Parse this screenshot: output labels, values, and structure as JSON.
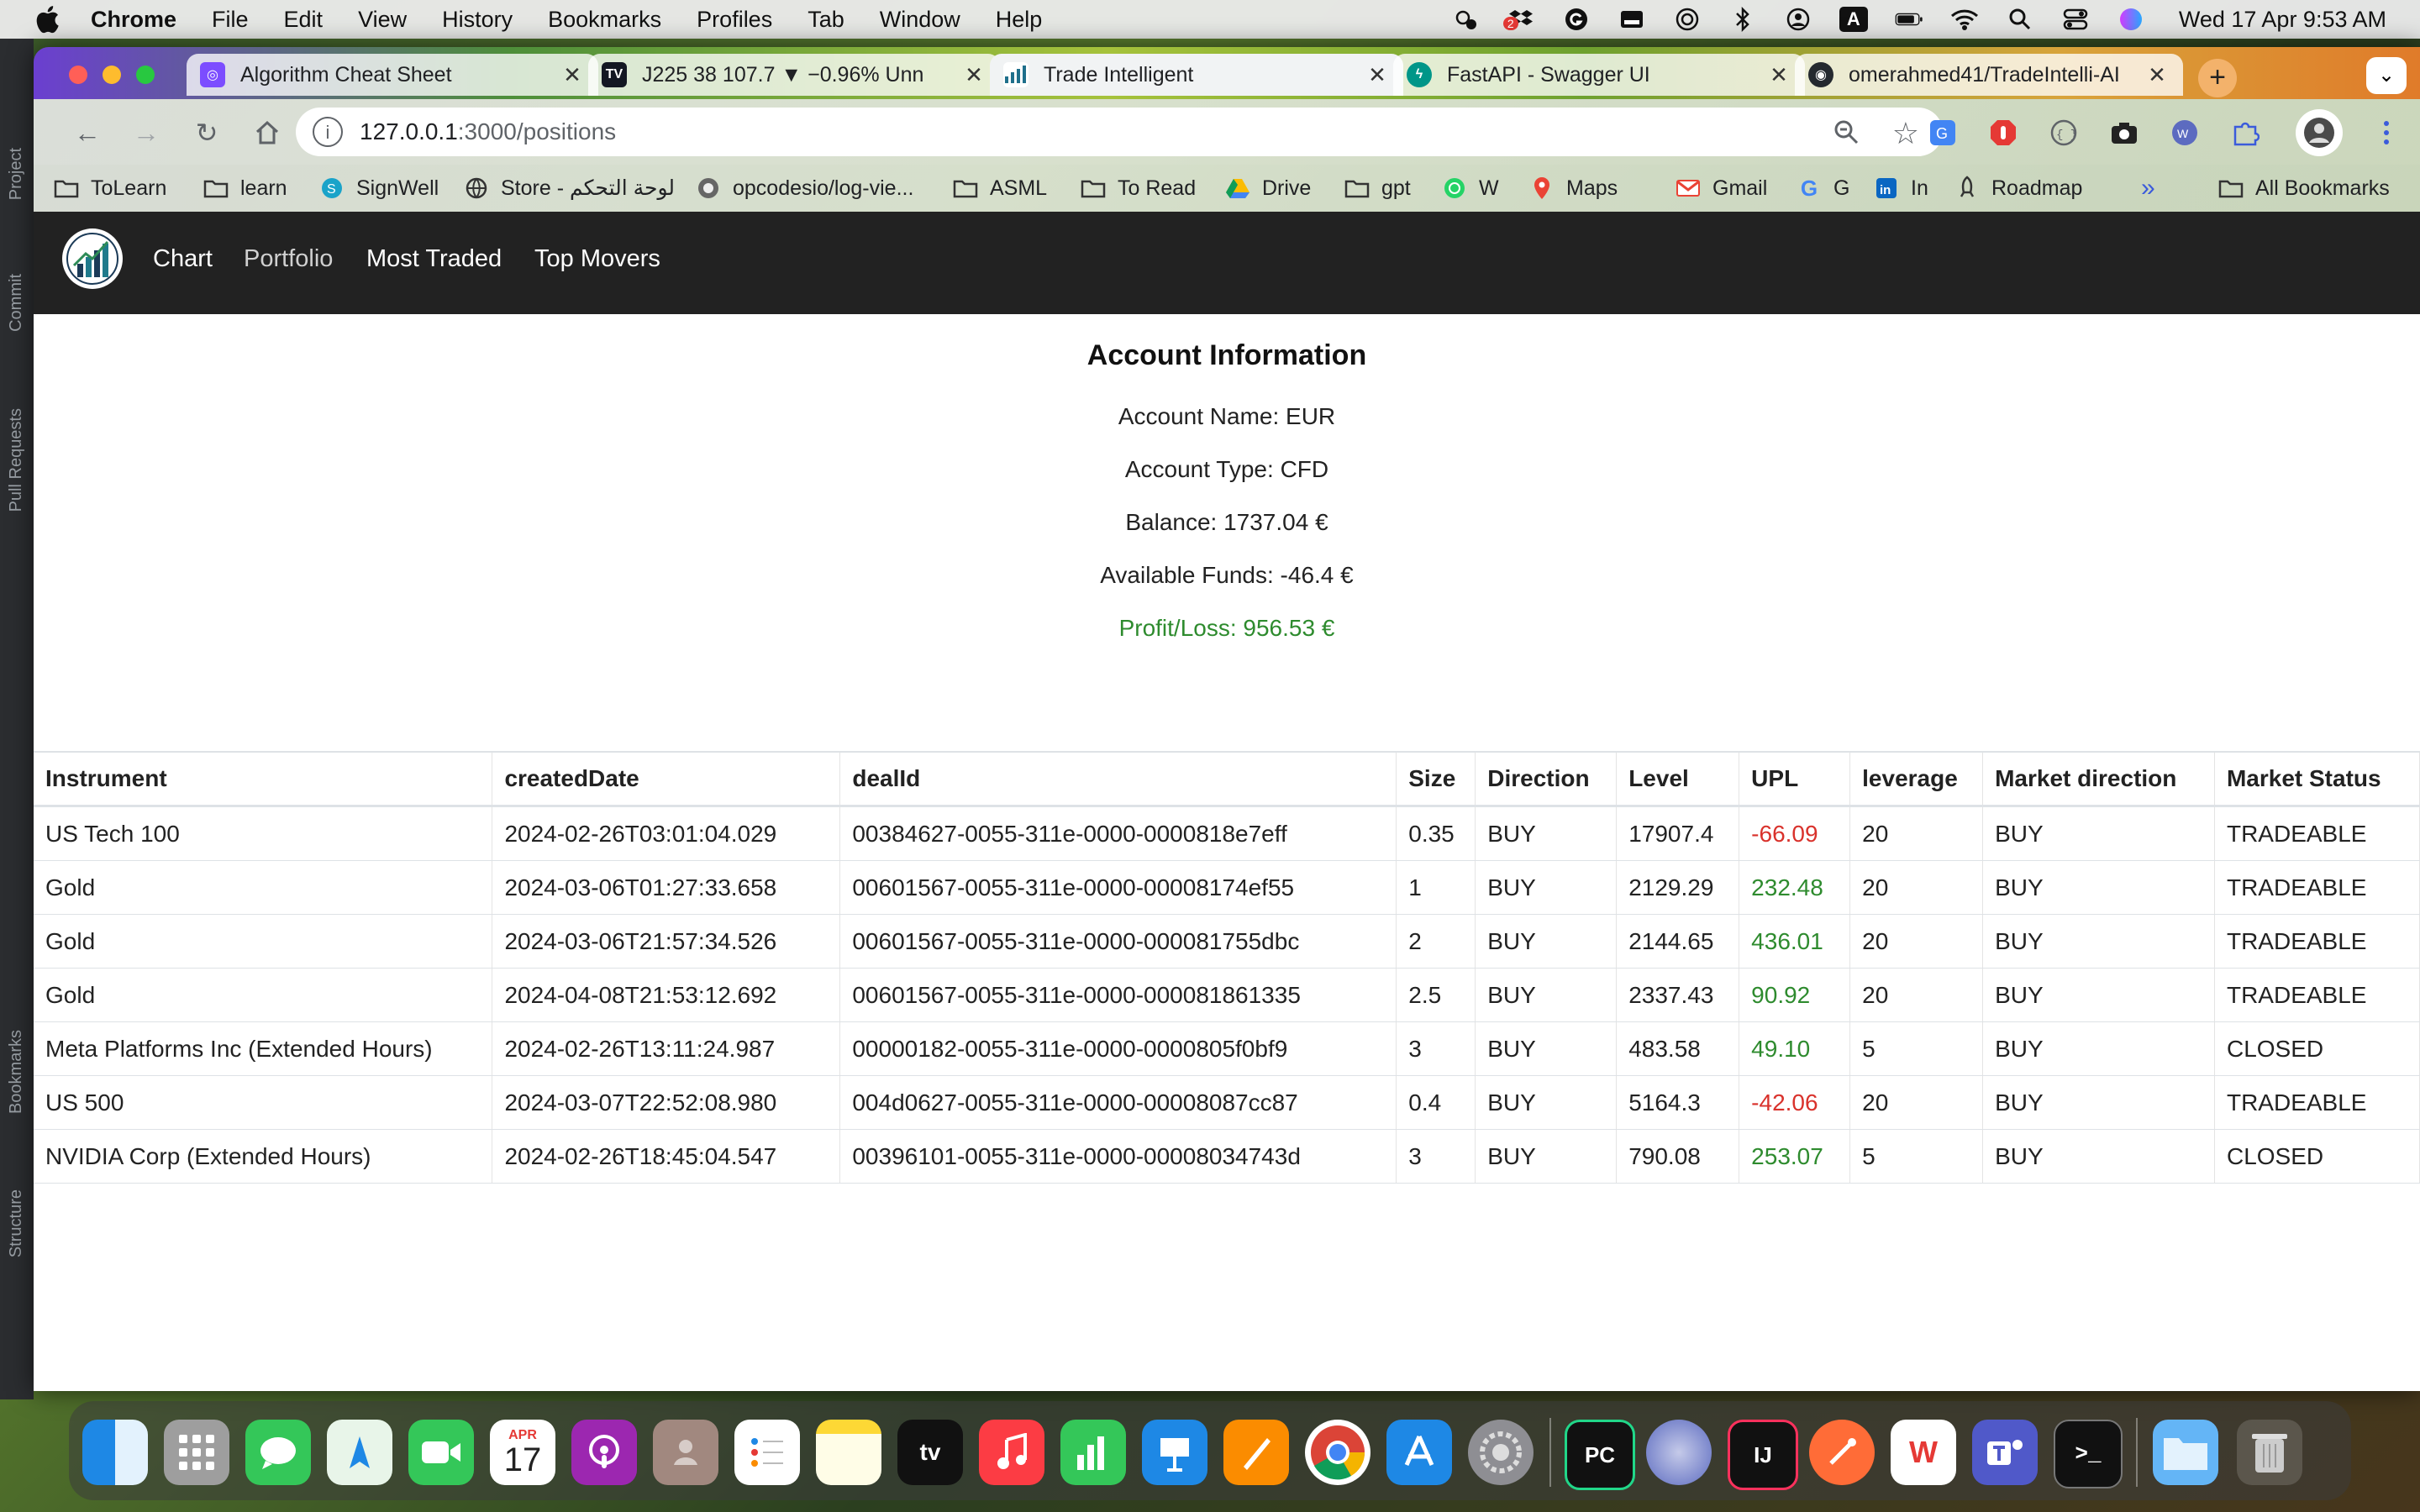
{
  "menubar": {
    "app_name": "Chrome",
    "items": [
      "File",
      "Edit",
      "View",
      "History",
      "Bookmarks",
      "Profiles",
      "Tab",
      "Window",
      "Help"
    ],
    "clock": "Wed 17 Apr  9:53 AM",
    "badge_count": "2",
    "input_source": "A"
  },
  "ide_strip": {
    "labels": [
      "Project",
      "Commit",
      "Pull Requests",
      "Bookmarks",
      "Structure"
    ]
  },
  "tabs": [
    {
      "title": "Algorithm Cheat Sheet",
      "icon": "web-icon",
      "active": false
    },
    {
      "title": "J225 38 107.7 ▼ −0.96% Unn",
      "icon": "tradingview-icon",
      "active": false
    },
    {
      "title": "Trade Intelligent",
      "icon": "chart-icon",
      "active": true
    },
    {
      "title": "FastAPI - Swagger UI",
      "icon": "fastapi-icon",
      "active": false
    },
    {
      "title": "omerahmed41/TradeIntelli-AI",
      "icon": "github-icon",
      "active": false
    }
  ],
  "toolbar": {
    "url_host": "127.0.0.1",
    "url_path": ":3000/positions"
  },
  "bookmarks": [
    {
      "label": "ToLearn",
      "icon": "folder-icon"
    },
    {
      "label": "learn",
      "icon": "folder-icon"
    },
    {
      "label": "SignWell",
      "icon": "signwell-icon"
    },
    {
      "label": "Store - لوحة التحكم",
      "icon": "globe-icon"
    },
    {
      "label": "opcodesio/log-vie...",
      "icon": "github-icon"
    },
    {
      "label": "ASML",
      "icon": "folder-icon"
    },
    {
      "label": "To Read",
      "icon": "folder-icon"
    },
    {
      "label": "Drive",
      "icon": "drive-icon"
    },
    {
      "label": "gpt",
      "icon": "folder-icon"
    },
    {
      "label": "W",
      "icon": "whatsapp-icon"
    },
    {
      "label": "Maps",
      "icon": "maps-icon"
    },
    {
      "label": "Gmail",
      "icon": "gmail-icon"
    },
    {
      "label": "G",
      "icon": "google-icon"
    },
    {
      "label": "In",
      "icon": "linkedin-icon"
    },
    {
      "label": "Roadmap",
      "icon": "rocket-icon"
    }
  ],
  "bookmarks_more": "»",
  "all_bookmarks": "All Bookmarks",
  "nav": {
    "links": [
      "Chart",
      "Portfolio",
      "Most Traded",
      "Top Movers"
    ],
    "active": "Portfolio"
  },
  "account": {
    "heading": "Account Information",
    "name": "Account Name: EUR",
    "type": "Account Type: CFD",
    "balance": "Balance: 1737.04 €",
    "available": "Available Funds: -46.4 €",
    "profit_loss": "Profit/Loss: 956.53 €"
  },
  "positions": {
    "columns": [
      "Instrument",
      "createdDate",
      "dealId",
      "Size",
      "Direction",
      "Level",
      "UPL",
      "leverage",
      "Market direction",
      "Market Status"
    ],
    "rows": [
      [
        "US Tech 100",
        "2024-02-26T03:01:04.029",
        "00384627-0055-311e-0000-0000818e7eff",
        "0.35",
        "BUY",
        "17907.4",
        "-66.09",
        "20",
        "BUY",
        "TRADEABLE"
      ],
      [
        "Gold",
        "2024-03-06T01:27:33.658",
        "00601567-0055-311e-0000-00008174ef55",
        "1",
        "BUY",
        "2129.29",
        "232.48",
        "20",
        "BUY",
        "TRADEABLE"
      ],
      [
        "Gold",
        "2024-03-06T21:57:34.526",
        "00601567-0055-311e-0000-000081755dbc",
        "2",
        "BUY",
        "2144.65",
        "436.01",
        "20",
        "BUY",
        "TRADEABLE"
      ],
      [
        "Gold",
        "2024-04-08T21:53:12.692",
        "00601567-0055-311e-0000-000081861335",
        "2.5",
        "BUY",
        "2337.43",
        "90.92",
        "20",
        "BUY",
        "TRADEABLE"
      ],
      [
        "Meta Platforms Inc (Extended Hours)",
        "2024-02-26T13:11:24.987",
        "00000182-0055-311e-0000-0000805f0bf9",
        "3",
        "BUY",
        "483.58",
        "49.10",
        "5",
        "BUY",
        "CLOSED"
      ],
      [
        "US 500",
        "2024-03-07T22:52:08.980",
        "004d0627-0055-311e-0000-00008087cc87",
        "0.4",
        "BUY",
        "5164.3",
        "-42.06",
        "20",
        "BUY",
        "TRADEABLE"
      ],
      [
        "NVIDIA Corp (Extended Hours)",
        "2024-02-26T18:45:04.547",
        "00396101-0055-311e-0000-00008034743d",
        "3",
        "BUY",
        "790.08",
        "253.07",
        "5",
        "BUY",
        "CLOSED"
      ]
    ]
  },
  "dock": {
    "apps": [
      "finder-icon",
      "launchpad-icon",
      "messages-icon",
      "maps-icon",
      "facetime-icon",
      "calendar-icon",
      "podcasts-icon",
      "contacts-icon",
      "reminders-icon",
      "notes-icon",
      "tv-icon",
      "music-icon",
      "numbers-icon",
      "keynote-icon",
      "pages-icon",
      "chrome-icon",
      "appstore-icon",
      "settings-icon",
      "pycharm-icon",
      "vpn-icon",
      "intellij-icon",
      "postman-icon",
      "wps-icon",
      "teams-icon",
      "terminal-icon",
      "downloads-folder-icon",
      "trash-icon"
    ],
    "calendar_month": "APR",
    "calendar_day": "17",
    "pycharm_label": "PC",
    "intellij_label": "IJ",
    "tv_label": "tv",
    "terminal_label": ">_"
  },
  "colors": {
    "navbar_bg": "#222222",
    "profit": "#2e8b2e",
    "loss": "#d9322c"
  }
}
